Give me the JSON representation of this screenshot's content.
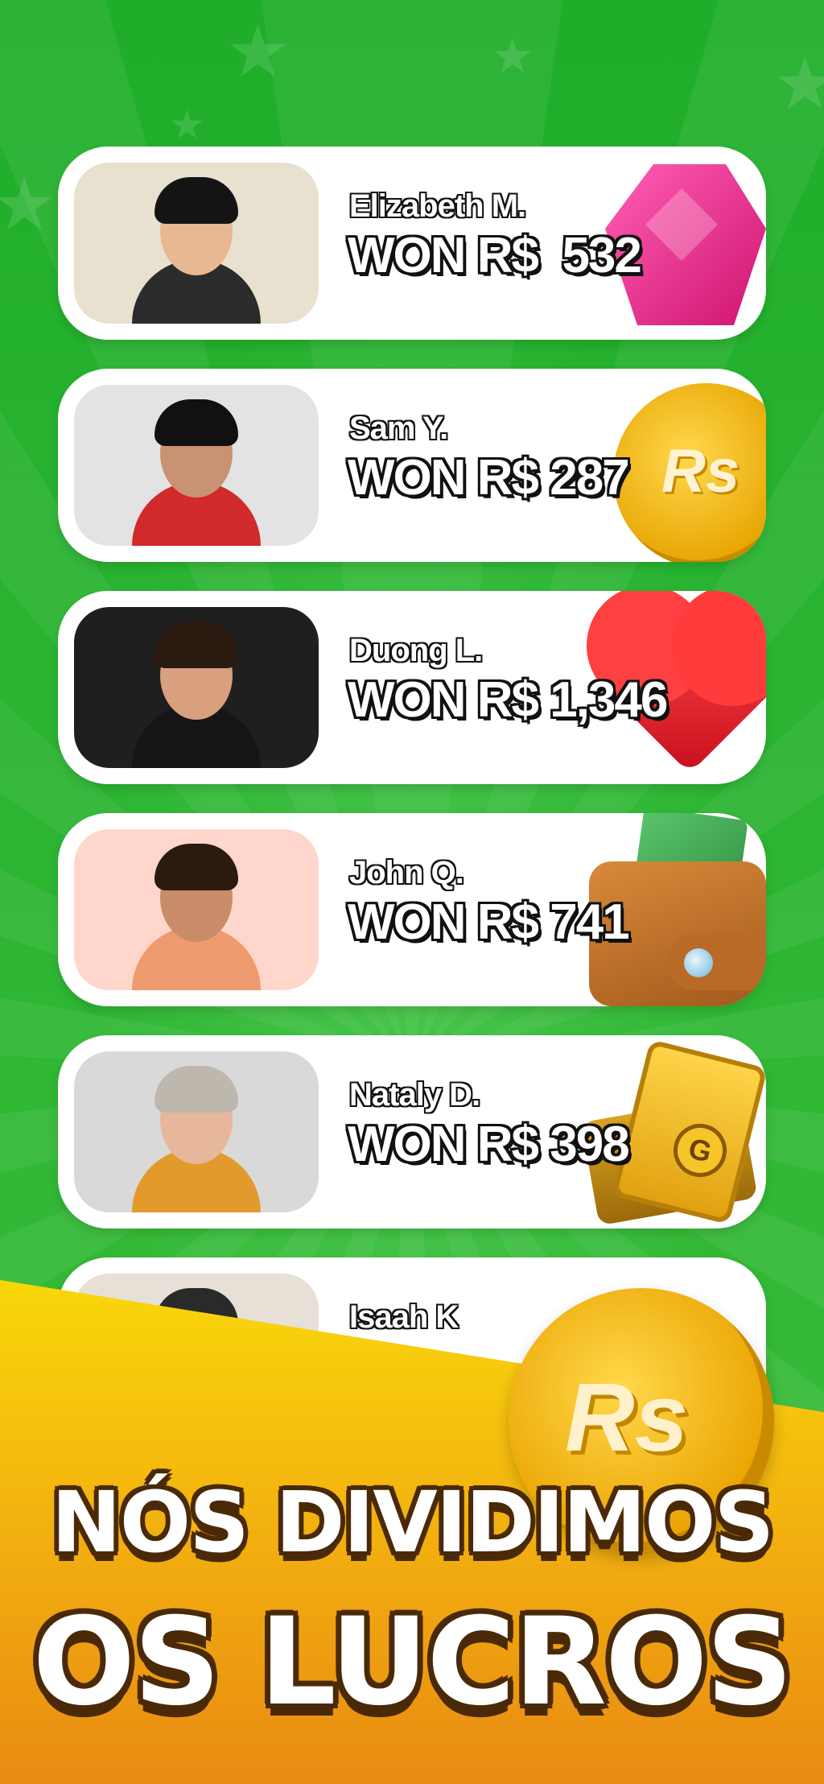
{
  "winners": [
    {
      "name": "Elizabeth M.",
      "amount": "WON R$  532",
      "photo_bg": "#e9e1cf",
      "skin": "#e8b893",
      "hair": "#141414",
      "shirt": "#2b2b2b",
      "icon": "gem-icon"
    },
    {
      "name": "Sam Y.",
      "amount": "WON R$ 287",
      "photo_bg": "#e3e3e3",
      "skin": "#c99272",
      "hair": "#111111",
      "shirt": "#d12a2a",
      "icon": "coin-icon"
    },
    {
      "name": "Duong L.",
      "amount": "WON R$ 1,346",
      "photo_bg": "#1f1f1f",
      "skin": "#d8a07e",
      "hair": "#2a1a10",
      "shirt": "#151515",
      "icon": "heart-icon"
    },
    {
      "name": "John Q.",
      "amount": "WON R$ 741",
      "photo_bg": "#ffd6cc",
      "skin": "#c88c68",
      "hair": "#2b1a10",
      "shirt": "#f09a70",
      "icon": "wallet-icon"
    },
    {
      "name": "Nataly D.",
      "amount": "WON R$ 398",
      "photo_bg": "#d9d9d9",
      "skin": "#e6b79b",
      "hair": "#bdb7ae",
      "shirt": "#e29a2c",
      "icon": "ticket-icon"
    },
    {
      "name": "Isaah K",
      "amount": "",
      "photo_bg": "#e6e0d6",
      "skin": "#c99a7c",
      "hair": "#2a2a2a",
      "shirt": "#777777",
      "icon": ""
    }
  ],
  "coin_label": "Rs",
  "ticket_label": "G",
  "headline": {
    "line1": "NÓS DIVIDIMOS",
    "line2": "OS LUCROS"
  },
  "colors": {
    "background": "#2db52d",
    "banner_top": "#f9d70a",
    "banner_bottom": "#e98a12",
    "outline": "#111111"
  }
}
